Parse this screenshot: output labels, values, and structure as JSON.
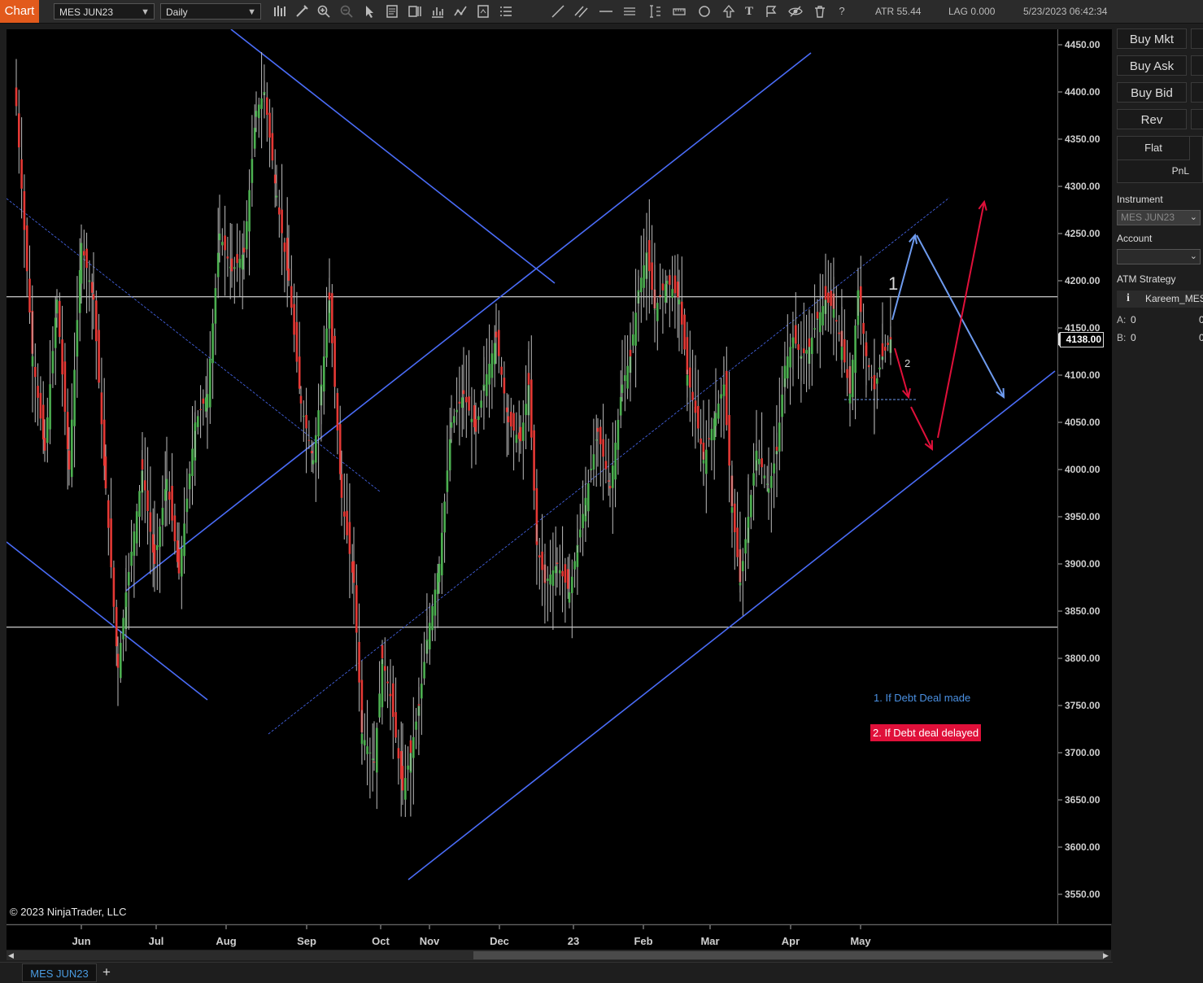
{
  "toolbar": {
    "chart_tab": "Chart",
    "instrument": "MES JUN23",
    "interval": "Daily",
    "atr": "ATR 55.44",
    "lag": "LAG 0.000",
    "datetime": "5/23/2023 06:42:34",
    "help": "?",
    "icon_text": "T"
  },
  "chart": {
    "copyright": "© 2023 NinjaTrader, LLC",
    "current_price": "4138.00",
    "annotations": {
      "label1": "1",
      "label2": "2",
      "blue_note": "1. If Debt Deal made",
      "red_note": "2. If Debt deal delayed"
    },
    "price_ticks": [
      "4450.00",
      "4400.00",
      "4350.00",
      "4300.00",
      "4250.00",
      "4200.00",
      "4150.00",
      "4100.00",
      "4050.00",
      "4000.00",
      "3950.00",
      "3900.00",
      "3850.00",
      "3800.00",
      "3750.00",
      "3700.00",
      "3650.00",
      "3600.00",
      "3550.00"
    ],
    "time_ticks": [
      "Jun",
      "Jul",
      "Aug",
      "Sep",
      "Oct",
      "Nov",
      "Dec",
      "23",
      "Feb",
      "Mar",
      "Apr",
      "May"
    ],
    "horizontal_lines": [
      4183,
      3833
    ],
    "colors": {
      "up": "#4caf50",
      "down": "#e53935",
      "trend": "#4a6cf7",
      "blue_arrow": "#6e9bef",
      "red_arrow": "#e0103a"
    }
  },
  "bottom": {
    "tab": "MES JUN23",
    "add": "+"
  },
  "panel": {
    "buttons": [
      "Buy Mkt",
      "Buy Ask",
      "Buy Bid",
      "Rev"
    ],
    "flat": "Flat",
    "pnl": "PnL",
    "instrument_label": "Instrument",
    "instrument_value": "MES JUN23",
    "account_label": "Account",
    "account_value": "",
    "atm_label": "ATM Strategy",
    "atm_info": "i",
    "atm_value": "Kareem_MES",
    "a_label": "A:",
    "a_value": "0",
    "a_value2": "0",
    "b_label": "B:",
    "b_value": "0",
    "b_value2": "0"
  }
}
